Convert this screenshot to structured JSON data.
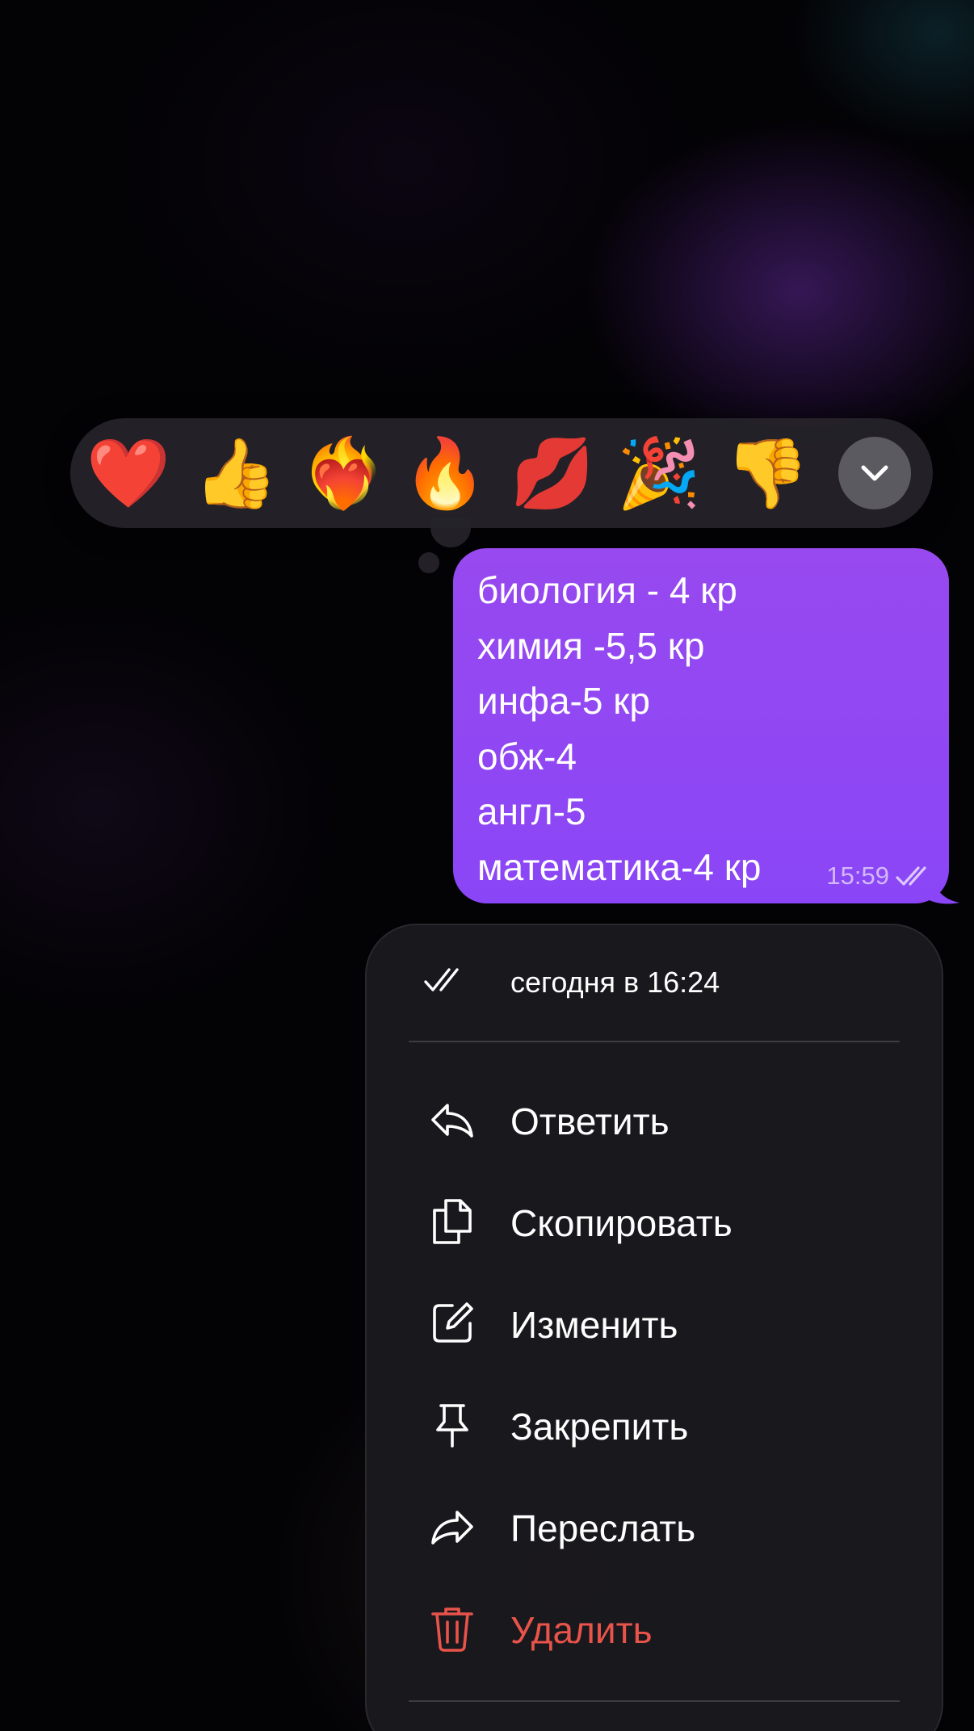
{
  "reactions": [
    {
      "emoji": "❤️",
      "name": "heart"
    },
    {
      "emoji": "👍",
      "name": "thumbs-up"
    },
    {
      "emoji": "❤️‍🔥",
      "name": "heart-on-fire"
    },
    {
      "emoji": "🔥",
      "name": "fire"
    },
    {
      "emoji": "💋",
      "name": "kiss"
    },
    {
      "emoji": "🎉",
      "name": "party-popper"
    },
    {
      "emoji": "👎",
      "name": "thumbs-down"
    }
  ],
  "expand_icon": "chevron-down-icon",
  "message": {
    "lines": [
      "биология - 4 кр",
      "химия -5,5 кр",
      "инфа-5 кр",
      "обж-4",
      "англ-5",
      "математика-4 кр"
    ],
    "time": "15:59",
    "status_icon": "double-check-icon"
  },
  "menu": {
    "read_status": "сегодня в 16:24",
    "items": [
      {
        "label": "Ответить",
        "icon": "reply-icon"
      },
      {
        "label": "Скопировать",
        "icon": "copy-icon"
      },
      {
        "label": "Изменить",
        "icon": "edit-icon"
      },
      {
        "label": "Закрепить",
        "icon": "pin-icon"
      },
      {
        "label": "Переслать",
        "icon": "forward-icon"
      },
      {
        "label": "Удалить",
        "icon": "trash-icon"
      }
    ]
  },
  "colors": {
    "bubble": "#8f47f3",
    "danger": "#e8534a",
    "menu_bg": "#1a191e"
  }
}
